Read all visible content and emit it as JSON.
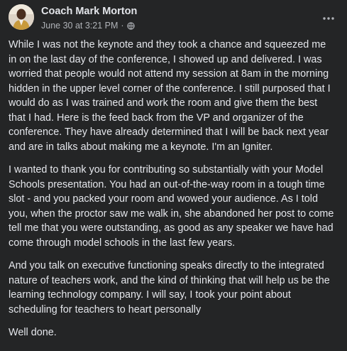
{
  "post": {
    "author": "Coach Mark Morton",
    "date": "June 30 at 3:21 PM",
    "separator": "·",
    "privacy_icon": "globe-icon",
    "more_icon": "more-horizontal-icon",
    "paragraphs": [
      "While I was not the keynote and they took a chance and squeezed me in on the last day of the conference, I showed up and delivered. I was worried that people would not attend my session at 8am in the morning hidden in the upper level corner of the conference. I still purposed that I would do as I was trained and work the room and give them the best that I had. Here is the feed back from the VP and organizer of the conference. They have already determined that I will be back next year and are in talks about making me a keynote. I'm an Igniter.",
      "I wanted to thank you for contributing so substantially with your Model Schools presentation.  You had an out-of-the-way room in a tough time slot - and you packed your room and wowed your audience.  As I told you, when the proctor saw me walk in, she abandoned her post to come tell me that you were outstanding, as good as any speaker we have had come through model schools in the last few years.",
      "And you talk on executive functioning speaks directly to the integrated nature of teachers work, and the kind of thinking that will help us be the learning technology company.  I will say, I took your point about scheduling for teachers to heart personally",
      "Well done."
    ]
  },
  "colors": {
    "background": "#242526",
    "text_primary": "#e4e6eb",
    "text_secondary": "#b0b3b8"
  }
}
